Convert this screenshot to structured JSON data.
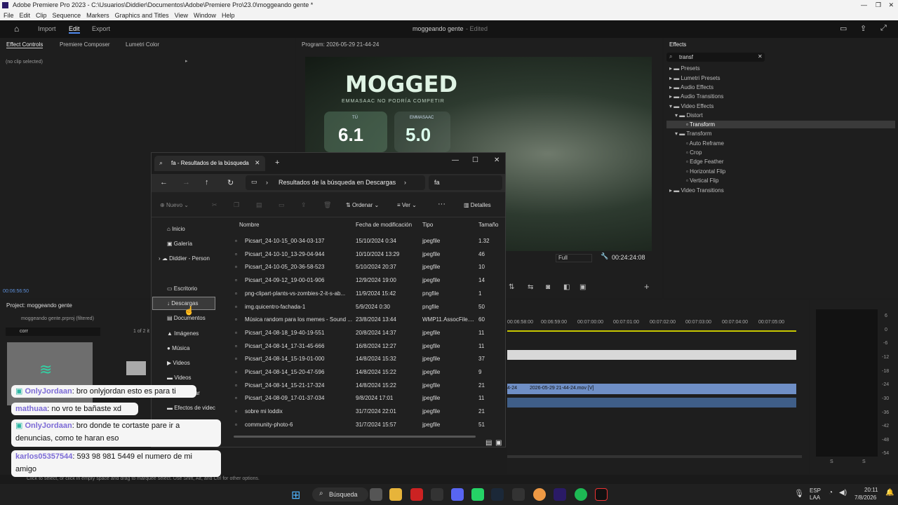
{
  "window": {
    "title": "Adobe Premiere Pro 2023 - C:\\Usuarios\\Diddier\\Documentos\\Adobe\\Premiere Pro\\23.0\\moggeando gente *"
  },
  "menu": [
    "File",
    "Edit",
    "Clip",
    "Sequence",
    "Markers",
    "Graphics and Titles",
    "View",
    "Window",
    "Help"
  ],
  "appbar": {
    "import": "Import",
    "edit": "Edit",
    "export": "Export",
    "project_title": "moggeando gente",
    "status": "- Edited"
  },
  "effect_controls": {
    "tab1": "Effect Controls",
    "tab2": "Premiere Composer",
    "tab3": "Lumetri Color",
    "no_clip": "(no clip selected)",
    "timecode": "00:06:56:50"
  },
  "program": {
    "title": "Program: 2026-05-29 21-44-24",
    "mogged": "MOGGED",
    "subtitle": "EMMASAAC NO PODRÍA COMPETIR",
    "tu": "TÚ",
    "score1": "6.1",
    "emmasaac": "EMMASAAC",
    "score2": "5.0",
    "zoom": "Full",
    "timecode": "00:24:24:08"
  },
  "effects": {
    "title": "Effects",
    "search": "transf",
    "items": [
      "Presets",
      "Lumetri Presets",
      "Audio Effects",
      "Audio Transitions",
      "Video Effects",
      "Distort",
      "Transform",
      "Transform",
      "Auto Reframe",
      "Crop",
      "Edge Feather",
      "Horizontal Flip",
      "Vertical Flip",
      "Video Transitions"
    ]
  },
  "project": {
    "title": "Project: moggeando gente",
    "file": "moggeando gente.prproj (filtered)",
    "search": "corr",
    "count": "1 of 2 it"
  },
  "timeline": {
    "ticks": [
      "00:06:58:00",
      "00:06:59:00",
      "00:07:00:00",
      "00:07:01:00",
      "00:07:02:00",
      "00:07:03:00",
      "00:07:04:00",
      "00:07:05:00"
    ],
    "clip_label": "2026-05-29 21-44-24.mov [V]",
    "clip_prefix": "4-24"
  },
  "meter": {
    "labels": [
      "6",
      "0",
      "-6",
      "-12",
      "-18",
      "-24",
      "-30",
      "-36",
      "-42",
      "-48",
      "-54"
    ],
    "s1": "S",
    "s2": "S"
  },
  "status": "Click to select, or click in empty space and drag to marquee select. Use Shift, Alt, and Ctrl for other options.",
  "explorer": {
    "tab": "fa - Resultados de la búsqueda",
    "address": "Resultados de la búsqueda en Descargas",
    "search": "fa",
    "new": "Nuevo",
    "sort": "Ordenar",
    "view": "Ver",
    "details": "Detalles",
    "cols": [
      "Nombre",
      "Fecha de modificación",
      "Tipo",
      "Tamaño"
    ],
    "sidebar": [
      "Inicio",
      "Galería",
      "Diddier - Person",
      "Escritorio",
      "Descargas",
      "Documentos",
      "Imágenes",
      "Música",
      "Videos",
      "Videos",
      "s de par",
      "Efectos de videc"
    ],
    "rows": [
      [
        "Picsart_24-10-15_00-34-03-137",
        "15/10/2024 0:34",
        "jpegfile",
        "1.32"
      ],
      [
        "Picsart_24-10-10_13-29-04-944",
        "10/10/2024 13:29",
        "jpegfile",
        "46"
      ],
      [
        "Picsart_24-10-05_20-36-58-523",
        "5/10/2024 20:37",
        "jpegfile",
        "10"
      ],
      [
        "Picsart_24-09-12_19-00-01-906",
        "12/9/2024 19:00",
        "jpegfile",
        "14"
      ],
      [
        "png-clipart-plants-vs-zombies-2-it-s-ab...",
        "11/9/2024 15:42",
        "pngfile",
        "1"
      ],
      [
        "img.quicentro-fachada-1",
        "5/9/2024 0:30",
        "pngfile",
        "50"
      ],
      [
        "Música random para los memes - Sound ...",
        "23/8/2024 13:44",
        "WMP11.AssocFile....",
        "60"
      ],
      [
        "Picsart_24-08-18_19-40-19-551",
        "20/8/2024 14:37",
        "jpegfile",
        "11"
      ],
      [
        "Picsart_24-08-14_17-31-45-666",
        "16/8/2024 12:27",
        "jpegfile",
        "11"
      ],
      [
        "Picsart_24-08-14_15-19-01-000",
        "14/8/2024 15:32",
        "jpegfile",
        "37"
      ],
      [
        "Picsart_24-08-14_15-20-47-596",
        "14/8/2024 15:22",
        "jpegfile",
        "9"
      ],
      [
        "Picsart_24-08-14_15-21-17-324",
        "14/8/2024 15:22",
        "jpegfile",
        "21"
      ],
      [
        "Picsart_24-08-09_17-01-37-034",
        "9/8/2024 17:01",
        "jpegfile",
        "11"
      ],
      [
        "sobre mi loddix",
        "31/7/2024 22:01",
        "jpegfile",
        "21"
      ],
      [
        "community-photo-6",
        "31/7/2024 15:57",
        "jpegfile",
        "51"
      ]
    ]
  },
  "chat": [
    {
      "user": "OnlyJordaan",
      "msg": ": bro onlyjordan esto es para ti"
    },
    {
      "user": "mathuaa",
      "msg": ": no vro te bañaste xd"
    },
    {
      "user": "OnlyJordaan",
      "msg": ": bro donde te cortaste pare ir a"
    },
    {
      "user": "",
      "msg": "denuncias, como te haran eso"
    },
    {
      "user": "karlos05357544",
      "msg": ": 593 98 981 5449 el numero de mi"
    },
    {
      "user": "",
      "msg": "amigo"
    }
  ],
  "taskbar": {
    "search": "Búsqueda",
    "lang1": "ESP",
    "lang2": "LAA",
    "time": "20:11",
    "date": "7/8/2026"
  }
}
